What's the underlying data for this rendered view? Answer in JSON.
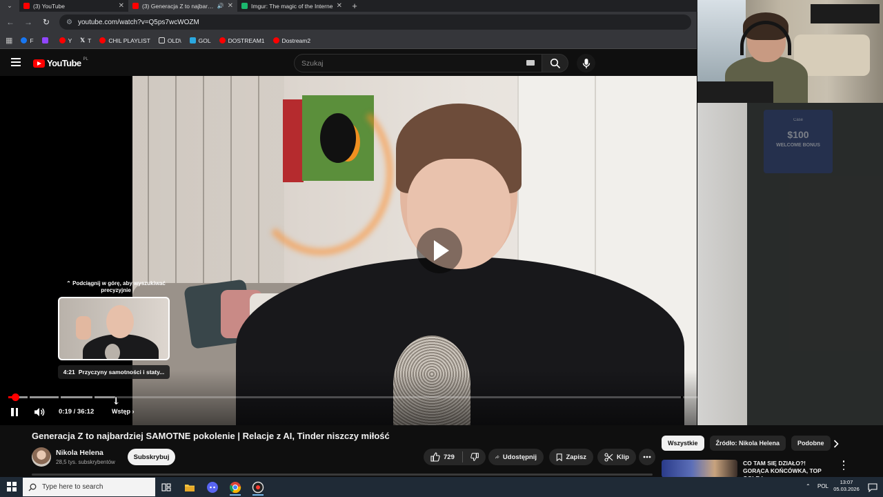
{
  "browser": {
    "tabs": [
      {
        "title": "(3) YouTube",
        "favicon_color": "#ff0000",
        "active": false
      },
      {
        "title": "(3) Generacja Z to najbardzi",
        "favicon_color": "#ff0000",
        "active": true,
        "playing_audio": true
      },
      {
        "title": "Imgur: The magic of the Interne",
        "favicon_color": "#1bb76e",
        "active": false
      }
    ],
    "url": "youtube.com/watch?v=Q5ps7wcWOZM",
    "bookmarks": [
      {
        "label": "F",
        "icon": "facebook-icon",
        "color": "#1877f2"
      },
      {
        "label": "",
        "icon": "twitch-icon",
        "color": "#9146ff"
      },
      {
        "label": "Y",
        "icon": "youtube-icon",
        "color": "#ff0000"
      },
      {
        "label": "T",
        "icon": "x-icon",
        "color": "#ffffff"
      },
      {
        "label": "CHIL PLAYLIST",
        "icon": "youtube-icon",
        "color": "#ff0000"
      },
      {
        "label": "OLD\\",
        "icon": "folder-icon",
        "color": "#dddddd"
      },
      {
        "label": "GOL",
        "icon": "gol-icon",
        "color": "#2aa8e0"
      },
      {
        "label": "DOSTREAM1",
        "icon": "youtube-icon",
        "color": "#ff0000"
      },
      {
        "label": "Dostream2",
        "icon": "youtube-icon",
        "color": "#ff0000"
      }
    ]
  },
  "youtube": {
    "logo_text": "YouTube",
    "country_code": "PL",
    "search_placeholder": "Szukaj"
  },
  "player": {
    "scrub_hint": "Podciągnij w górę, aby wyszukiwać precyzyjnie",
    "preview_time": "4:21",
    "preview_chapter": "Przyczyny samotności i staty...",
    "time_display": "0:19 / 36:12",
    "current_chapter": "Wstęp",
    "played_fraction": 0.009,
    "loaded_fraction": 0.145,
    "hover_fraction": 0.145,
    "status": "paused-overlay"
  },
  "webcam_promo": {
    "brand": "Case",
    "amount": "$100",
    "label": "WELCOME BONUS"
  },
  "video": {
    "title": "Generacja Z to najbardziej SAMOTNE pokolenie | Relacje z AI, Tinder niszczy miłość",
    "channel_name": "Nikola Helena",
    "subscribers": "28,5 tys. subskrybentów",
    "subscribe_label": "Subskrybuj",
    "likes": "729",
    "share_label": "Udostępnij",
    "save_label": "Zapisz",
    "clip_label": "Klip"
  },
  "sidebar": {
    "chips": [
      "Wszystkie",
      "Źródło: Nikola Helena",
      "Podobne"
    ],
    "selected_chip": "Wszystkie",
    "recommendation_title": "CO TAM SIĘ DZIAŁO?! GORĄCA KOŃCÓWKA, TOP GOLE I ..."
  },
  "taskbar": {
    "search_placeholder": "Type here to search",
    "language": "POL",
    "time": "13:07",
    "date": "05.03.2026"
  }
}
